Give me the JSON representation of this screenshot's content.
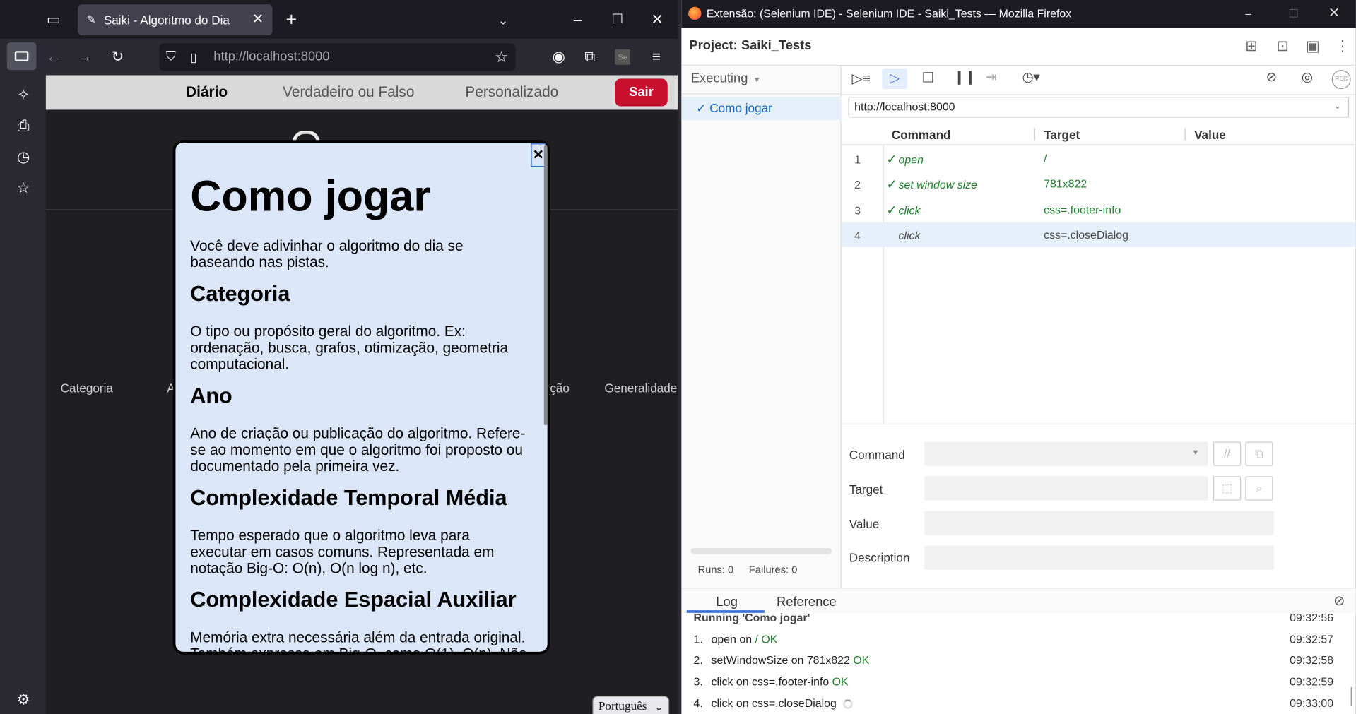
{
  "left_browser": {
    "tab_title": "Saiki - Algoritmo do Dia",
    "url_host": "http://localhost",
    "url_port": ":8000",
    "site": {
      "nav": [
        "Diário",
        "Verdadeiro ou Falso",
        "Personalizado"
      ],
      "logout": "Sair",
      "columns": [
        "Categoria",
        "A",
        "ção",
        "Generalidade"
      ],
      "language": "Português"
    },
    "modal": {
      "close": "×",
      "title": "Como jogar",
      "intro": "Você deve adivinhar o algoritmo do dia se baseando nas pistas.",
      "sections": [
        {
          "heading": "Categoria",
          "text": "O tipo ou propósito geral do algoritmo. Ex: ordenação, busca, grafos, otimização, geometria computacional."
        },
        {
          "heading": "Ano",
          "text": "Ano de criação ou publicação do algoritmo. Refere-se ao momento em que o algoritmo foi proposto ou documentado pela primeira vez."
        },
        {
          "heading": "Complexidade Temporal Média",
          "text": "Tempo esperado que o algoritmo leva para executar em casos comuns. Representada em notação Big-O: O(n), O(n log n), etc."
        },
        {
          "heading": "Complexidade Espacial Auxiliar",
          "text": "Memória extra necessária além da entrada original. Também expressa em Big-O, como O(1), O(n). Não conta a memória ocupada pelos dados de entrada."
        }
      ]
    }
  },
  "selenium": {
    "window_title": "Extensão: (Selenium IDE) - Selenium IDE - Saiki_Tests — Mozilla Firefox",
    "project_label": "Project:",
    "project_name": "Saiki_Tests",
    "suite_dropdown": "Executing",
    "test_name": "Como jogar",
    "base_url": "http://localhost:8000",
    "columns": {
      "command": "Command",
      "target": "Target",
      "value": "Value"
    },
    "commands": [
      {
        "n": "1",
        "command": "open",
        "target": "/",
        "status": "passed"
      },
      {
        "n": "2",
        "command": "set window size",
        "target": "781x822",
        "status": "passed"
      },
      {
        "n": "3",
        "command": "click",
        "target": "css=.footer-info",
        "status": "passed"
      },
      {
        "n": "4",
        "command": "click",
        "target": "css=.closeDialog",
        "status": "running"
      }
    ],
    "editor": {
      "command": "Command",
      "target": "Target",
      "value": "Value",
      "description": "Description"
    },
    "runs": "Runs: 0",
    "failures": "Failures: 0",
    "tabs": [
      "Log",
      "Reference"
    ],
    "log": {
      "header": "Running 'Como jogar'",
      "header_time": "09:32:56",
      "entries": [
        {
          "n": "1.",
          "pre": "open on ",
          "target": "/",
          "result": "OK",
          "time": "09:32:57"
        },
        {
          "n": "2.",
          "pre": "setWindowSize on 781x822",
          "target": "",
          "result": "OK",
          "time": "09:32:58"
        },
        {
          "n": "3.",
          "pre": "click on css=.footer-info",
          "target": "",
          "result": "OK",
          "time": "09:32:59"
        },
        {
          "n": "4.",
          "pre": "click on css=.closeDialog",
          "target": "",
          "result": "",
          "time": "09:33:00"
        }
      ]
    },
    "rec": "REC"
  }
}
